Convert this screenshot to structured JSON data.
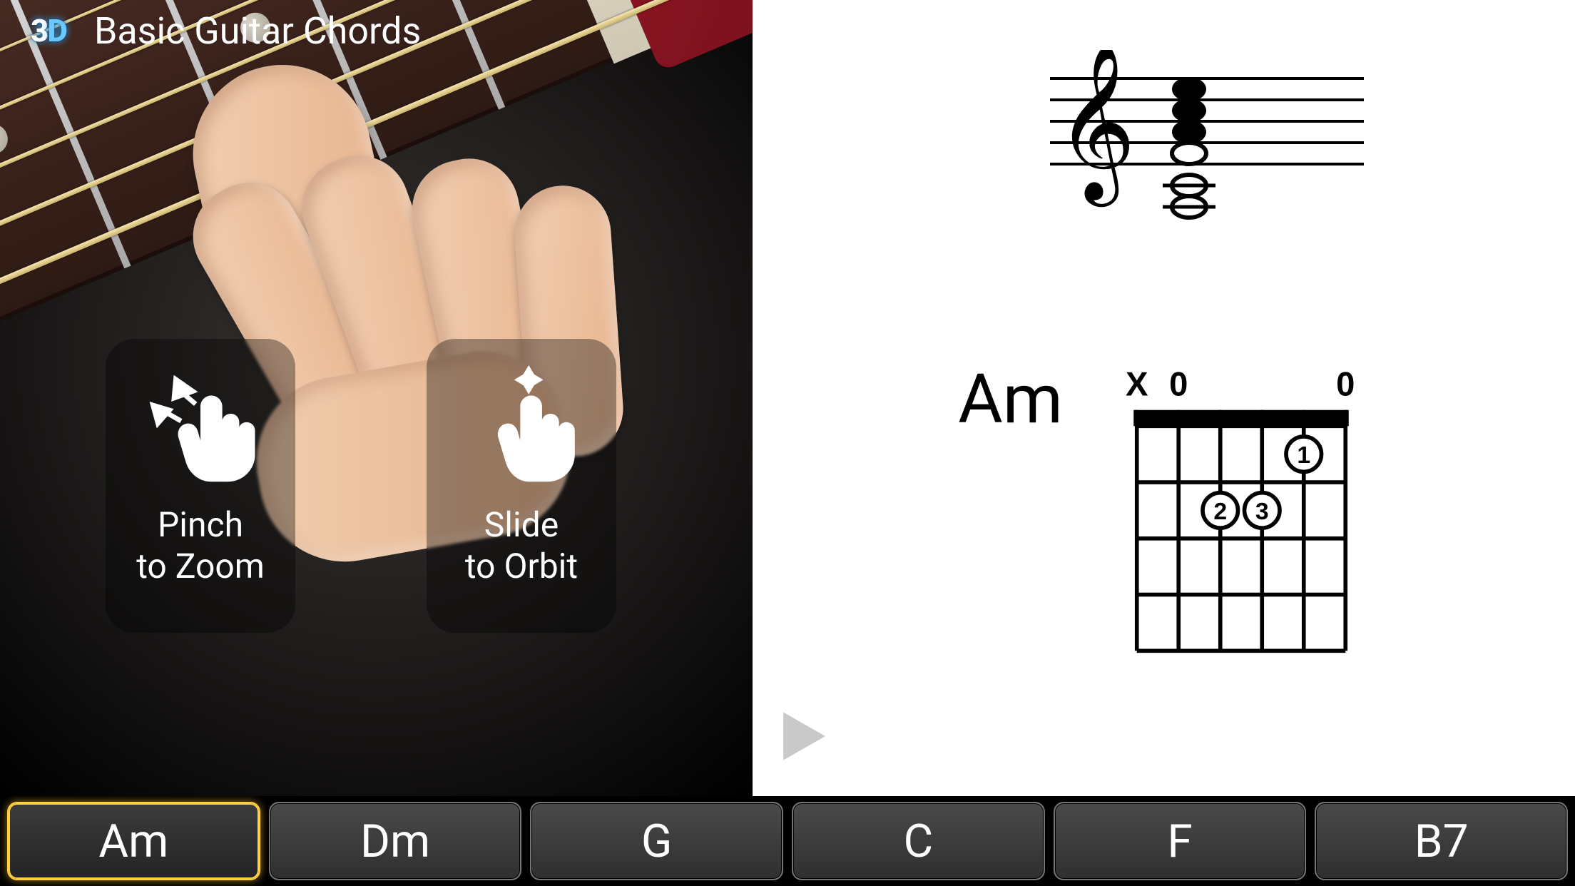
{
  "app": {
    "title": "Basic Guitar Chords",
    "logo_text_a": "3",
    "logo_text_b": "D"
  },
  "gestures": {
    "pinch": {
      "line1": "Pinch",
      "line2": "to Zoom",
      "icon": "pinch-icon"
    },
    "slide": {
      "line1": "Slide",
      "line2": "to Orbit",
      "icon": "pan-icon"
    }
  },
  "current_chord": {
    "name": "Am",
    "diagram": {
      "open_strings": [
        "X",
        "0",
        "",
        "",
        "",
        "0"
      ],
      "fingers": [
        {
          "string": 2,
          "fret": 1,
          "label": "1"
        },
        {
          "string": 4,
          "fret": 2,
          "label": "2"
        },
        {
          "string": 3,
          "fret": 2,
          "label": "3"
        }
      ],
      "frets_shown": 4
    },
    "staff": {
      "clef": "treble",
      "note_count": 5
    }
  },
  "play_button": {
    "icon": "play-icon"
  },
  "chord_list": [
    {
      "label": "Am",
      "active": true
    },
    {
      "label": "Dm",
      "active": false
    },
    {
      "label": "G",
      "active": false
    },
    {
      "label": "C",
      "active": false
    },
    {
      "label": "F",
      "active": false
    },
    {
      "label": "B7",
      "active": false
    }
  ]
}
